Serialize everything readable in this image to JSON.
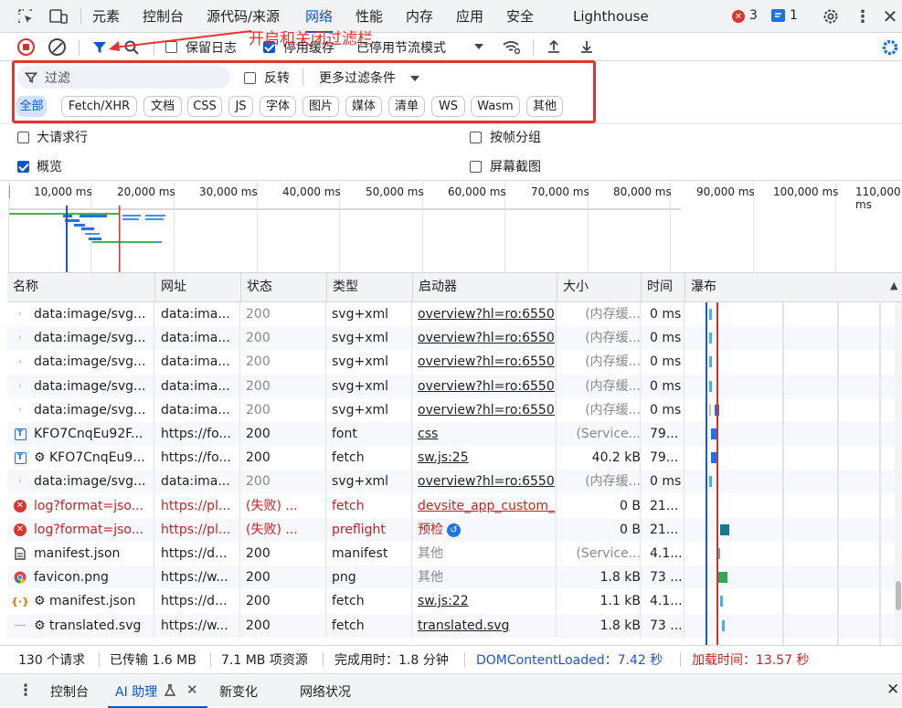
{
  "tabs": [
    "元素",
    "控制台",
    "源代码/来源",
    "网络",
    "性能",
    "内存",
    "应用",
    "安全",
    "Lighthouse"
  ],
  "badges": {
    "errors": "3",
    "messages": "1"
  },
  "toolbar": {
    "preserve_log": "保留日志",
    "disable_cache": "停用缓存",
    "throttle": "已停用节流模式"
  },
  "annotation": "开启和关闭过滤栏",
  "filter": {
    "placeholder": "过滤",
    "invert": "反转",
    "more": "更多过滤条件"
  },
  "chips": [
    "全部",
    "Fetch/XHR",
    "文档",
    "CSS",
    "JS",
    "字体",
    "图片",
    "媒体",
    "清单",
    "WS",
    "Wasm",
    "其他"
  ],
  "options": {
    "big_rows": "大请求行",
    "group_by_frame": "按帧分组",
    "overview": "概览",
    "screenshots": "屏幕截图"
  },
  "timeline_ticks": [
    "10,000 ms",
    "20,000 ms",
    "30,000 ms",
    "40,000 ms",
    "50,000 ms",
    "60,000 ms",
    "70,000 ms",
    "80,000 ms",
    "90,000 ms",
    "100,000 ms",
    "110,000 ms"
  ],
  "columns": [
    "名称",
    "网址",
    "状态",
    "类型",
    "启动器",
    "大小",
    "时间",
    "瀑布"
  ],
  "rows": [
    {
      "name": "data:image/svg...",
      "url": "data:ima...",
      "status": "200",
      "type": "svg+xml",
      "initiator": "overview?hl=ro:6550",
      "size": "(内存缓...",
      "time": "0 ms",
      "icon": "svg-icon",
      "kind": "cache"
    },
    {
      "name": "data:image/svg...",
      "url": "data:ima...",
      "status": "200",
      "type": "svg+xml",
      "initiator": "overview?hl=ro:6550",
      "size": "(内存缓...",
      "time": "0 ms",
      "icon": "svg-icon",
      "kind": "cache"
    },
    {
      "name": "data:image/svg...",
      "url": "data:ima...",
      "status": "200",
      "type": "svg+xml",
      "initiator": "overview?hl=ro:6550",
      "size": "(内存缓...",
      "time": "0 ms",
      "icon": "svg-icon",
      "kind": "cache"
    },
    {
      "name": "data:image/svg...",
      "url": "data:ima...",
      "status": "200",
      "type": "svg+xml",
      "initiator": "overview?hl=ro:6550",
      "size": "(内存缓...",
      "time": "0 ms",
      "icon": "svg-icon",
      "kind": "cache"
    },
    {
      "name": "data:image/svg...",
      "url": "data:ima...",
      "status": "200",
      "type": "svg+xml",
      "initiator": "overview?hl=ro:6550",
      "size": "(内存缓...",
      "time": "0 ms",
      "icon": "svg-icon",
      "kind": "cache"
    },
    {
      "name": "KFO7CnqEu92F...",
      "url": "https://fo...",
      "status": "200",
      "type": "font",
      "initiator": "css",
      "size": "(Service...",
      "time": "79...",
      "icon": "font-icon",
      "kind": "font"
    },
    {
      "name": "⚙ KFO7CnqEu9...",
      "url": "https://fo...",
      "status": "200",
      "type": "fetch",
      "initiator": "sw.js:25",
      "size": "40.2 kB",
      "time": "79...",
      "icon": "font-icon",
      "kind": "fetch"
    },
    {
      "name": "data:image/svg...",
      "url": "data:ima...",
      "status": "200",
      "type": "svg+xml",
      "initiator": "overview?hl=ro:6550",
      "size": "(内存缓...",
      "time": "0 ms",
      "icon": "svg-icon",
      "kind": "cache"
    },
    {
      "name": "log?format=jso...",
      "url": "https://pl...",
      "status": "(失败) ...",
      "type": "fetch",
      "initiator": "devsite_app_custom_",
      "size": "0 B",
      "time": "21...",
      "icon": "error-icon",
      "kind": "error"
    },
    {
      "name": "log?format=jso...",
      "url": "https://pl...",
      "status": "(失败) ...",
      "type": "preflight",
      "initiator": "预检",
      "size": "0 B",
      "time": "21...",
      "icon": "error-icon",
      "kind": "error"
    },
    {
      "name": "manifest.json",
      "url": "https://d...",
      "status": "200",
      "type": "manifest",
      "initiator": "其他",
      "size": "(Service...",
      "time": "4.1...",
      "icon": "document-icon",
      "kind": "plain"
    },
    {
      "name": "favicon.png",
      "url": "https://w...",
      "status": "200",
      "type": "png",
      "initiator": "其他",
      "size": "1.8 kB",
      "time": "73 ...",
      "icon": "chrome-icon",
      "kind": "plain"
    },
    {
      "name": "⚙ manifest.json",
      "url": "https://d...",
      "status": "200",
      "type": "fetch",
      "initiator": "sw.js:22",
      "size": "1.1 kB",
      "time": "4.1...",
      "icon": "json-icon",
      "kind": "fetch"
    },
    {
      "name": "⚙ translated.svg",
      "url": "https://w...",
      "status": "200",
      "type": "fetch",
      "initiator": "translated.svg",
      "size": "1.8 kB",
      "time": "73 ...",
      "icon": "dash-icon",
      "kind": "fetch"
    }
  ],
  "status": {
    "requests": "130 个请求",
    "transferred": "已传输 1.6 MB",
    "resources": "7.1 MB 项资源",
    "finish": "完成用时：1.8 分钟",
    "dcl": "DOMContentLoaded：7.42 秒",
    "load": "加载时间：13.57 秒"
  },
  "drawer": {
    "console": "控制台",
    "ai": "AI 助理",
    "whats_new": "新变化",
    "network_conditions": "网络状况"
  },
  "colors": {
    "accent": "#0b57d0",
    "error": "#c5221f",
    "annotation": "#e8322f"
  }
}
